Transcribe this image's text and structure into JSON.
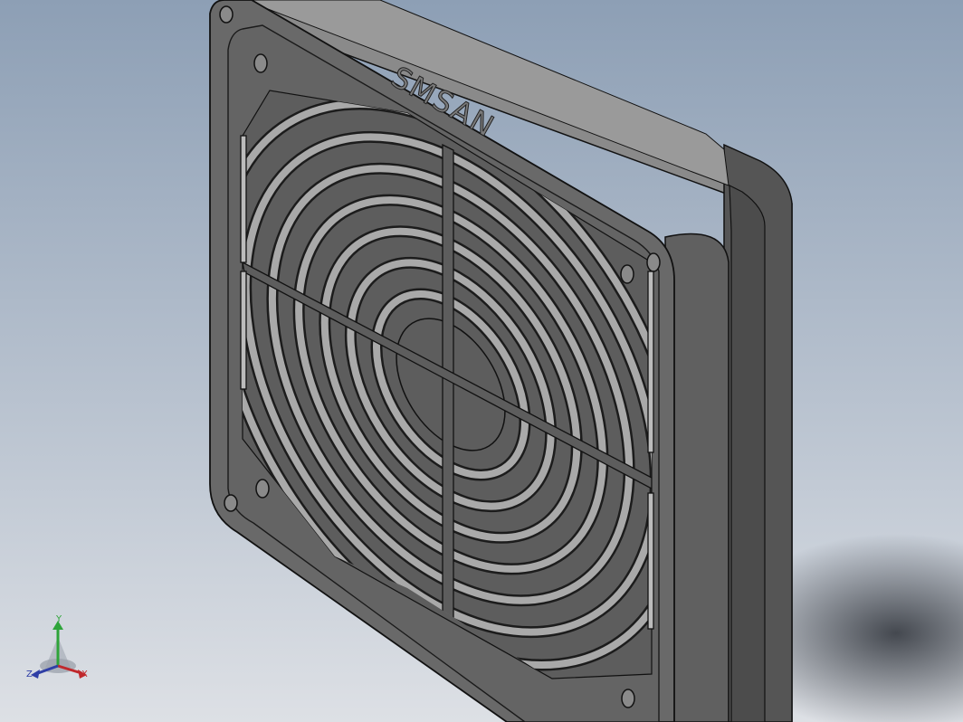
{
  "viewport": {
    "background_top": "#8d9fb5",
    "background_bottom": "#d9dde3",
    "part_color": "#6a6a6a",
    "part_face_color": "#5b5b5b",
    "edge_color": "#111111"
  },
  "model": {
    "brand_text": "SMSAN"
  },
  "triad": {
    "x_label": "X",
    "y_label": "Y",
    "z_label": "Z",
    "x_color": "#c0282c",
    "y_color": "#2ea43a",
    "z_color": "#2f3fa6"
  }
}
